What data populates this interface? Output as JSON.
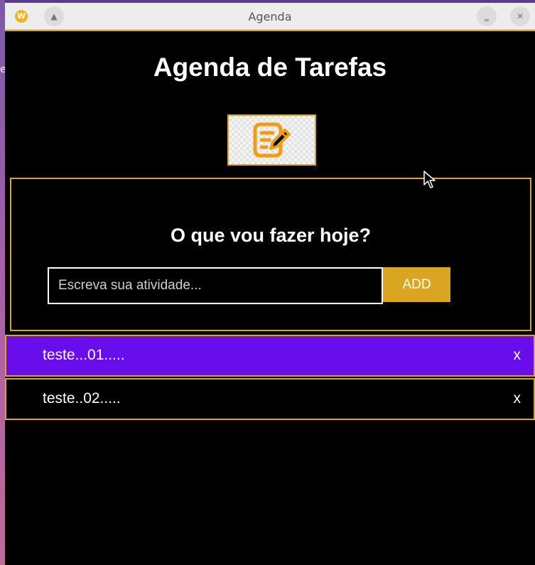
{
  "window": {
    "title": "Agenda",
    "app_icon_letter": "W",
    "shade_glyph": "▲",
    "minimize_glyph": "‗",
    "close_glyph": "✕"
  },
  "desktop": {
    "edge_char": "e"
  },
  "page": {
    "title": "Agenda de Tarefas"
  },
  "logo": {
    "icon": "edit-note-icon",
    "color": "#f39c12"
  },
  "form": {
    "heading": "O que vou fazer hoje?",
    "input_placeholder": "Escreva sua atividade...",
    "input_value": "",
    "add_label": "ADD"
  },
  "tasks": [
    {
      "text": "teste...01.....",
      "delete_label": "x",
      "state": "highlighted"
    },
    {
      "text": "teste..02.....",
      "delete_label": "x",
      "state": "normal"
    }
  ],
  "colors": {
    "accent_gold": "#daa520",
    "highlight_purple": "#6a0ded",
    "background": "#000000",
    "text": "#ffffff"
  }
}
